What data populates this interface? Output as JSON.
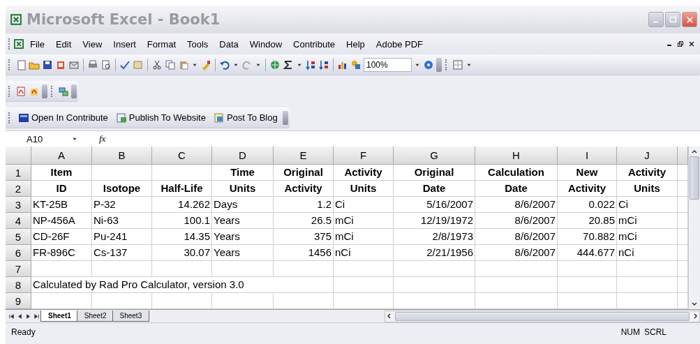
{
  "window": {
    "title": "Microsoft Excel - Book1"
  },
  "menu": [
    "File",
    "Edit",
    "View",
    "Insert",
    "Format",
    "Tools",
    "Data",
    "Window",
    "Contribute",
    "Help",
    "Adobe PDF"
  ],
  "toolbar": {
    "zoom": "100%"
  },
  "contribute_toolbar": [
    "Open In Contribute",
    "Publish To Website",
    "Post To Blog"
  ],
  "formula_bar": {
    "name_box": "A10",
    "function_label": "fx"
  },
  "columns": [
    "A",
    "B",
    "C",
    "D",
    "E",
    "F",
    "G",
    "H",
    "I",
    "J"
  ],
  "rows": [
    {
      "number": "1",
      "kind": "header",
      "cells": {
        "A": "Item",
        "D": "Time",
        "E": "Original",
        "F": "Activity",
        "G": "Original",
        "H": "Calculation",
        "I": "New",
        "J": "Activity"
      }
    },
    {
      "number": "2",
      "kind": "header",
      "cells": {
        "A": "ID",
        "B": "Isotope",
        "C": "Half-Life",
        "D": "Units",
        "E": "Activity",
        "F": "Units",
        "G": "Date",
        "H": "Date",
        "I": "Activity",
        "J": "Units"
      }
    },
    {
      "number": "3",
      "kind": "data",
      "cells": {
        "A": "KT-25B",
        "B": "P-32",
        "C": "14.262",
        "D": "Days",
        "E": "1.2",
        "F": "Ci",
        "G": "5/16/2007",
        "H": "8/6/2007",
        "I": "0.022",
        "J": "Ci"
      }
    },
    {
      "number": "4",
      "kind": "data",
      "cells": {
        "A": "NP-456A",
        "B": "Ni-63",
        "C": "100.1",
        "D": "Years",
        "E": "26.5",
        "F": "mCi",
        "G": "12/19/1972",
        "H": "8/6/2007",
        "I": "20.85",
        "J": "mCi"
      }
    },
    {
      "number": "5",
      "kind": "data",
      "cells": {
        "A": "CD-26F",
        "B": "Pu-241",
        "C": "14.35",
        "D": "Years",
        "E": "375",
        "F": "mCi",
        "G": "2/8/1973",
        "H": "8/6/2007",
        "I": "70.882",
        "J": "mCi"
      }
    },
    {
      "number": "6",
      "kind": "data",
      "cells": {
        "A": "FR-896C",
        "B": "Cs-137",
        "C": "30.07",
        "D": "Years",
        "E": "1456",
        "F": "nCi",
        "G": "2/21/1956",
        "H": "8/6/2007",
        "I": "444.677",
        "J": "nCi"
      }
    },
    {
      "number": "7",
      "kind": "data",
      "cells": {}
    },
    {
      "number": "8",
      "kind": "note",
      "cells": {
        "A": "Calculated by Rad Pro Calculator, version 3.0"
      }
    },
    {
      "number": "9",
      "kind": "data",
      "cells": {}
    }
  ],
  "sheet_tabs": [
    {
      "label": "Sheet1",
      "selected": true
    },
    {
      "label": "Sheet2",
      "selected": false
    },
    {
      "label": "Sheet3",
      "selected": false
    }
  ],
  "status_bar": {
    "text": "Ready",
    "indicators": [
      "NUM",
      "SCRL"
    ]
  }
}
